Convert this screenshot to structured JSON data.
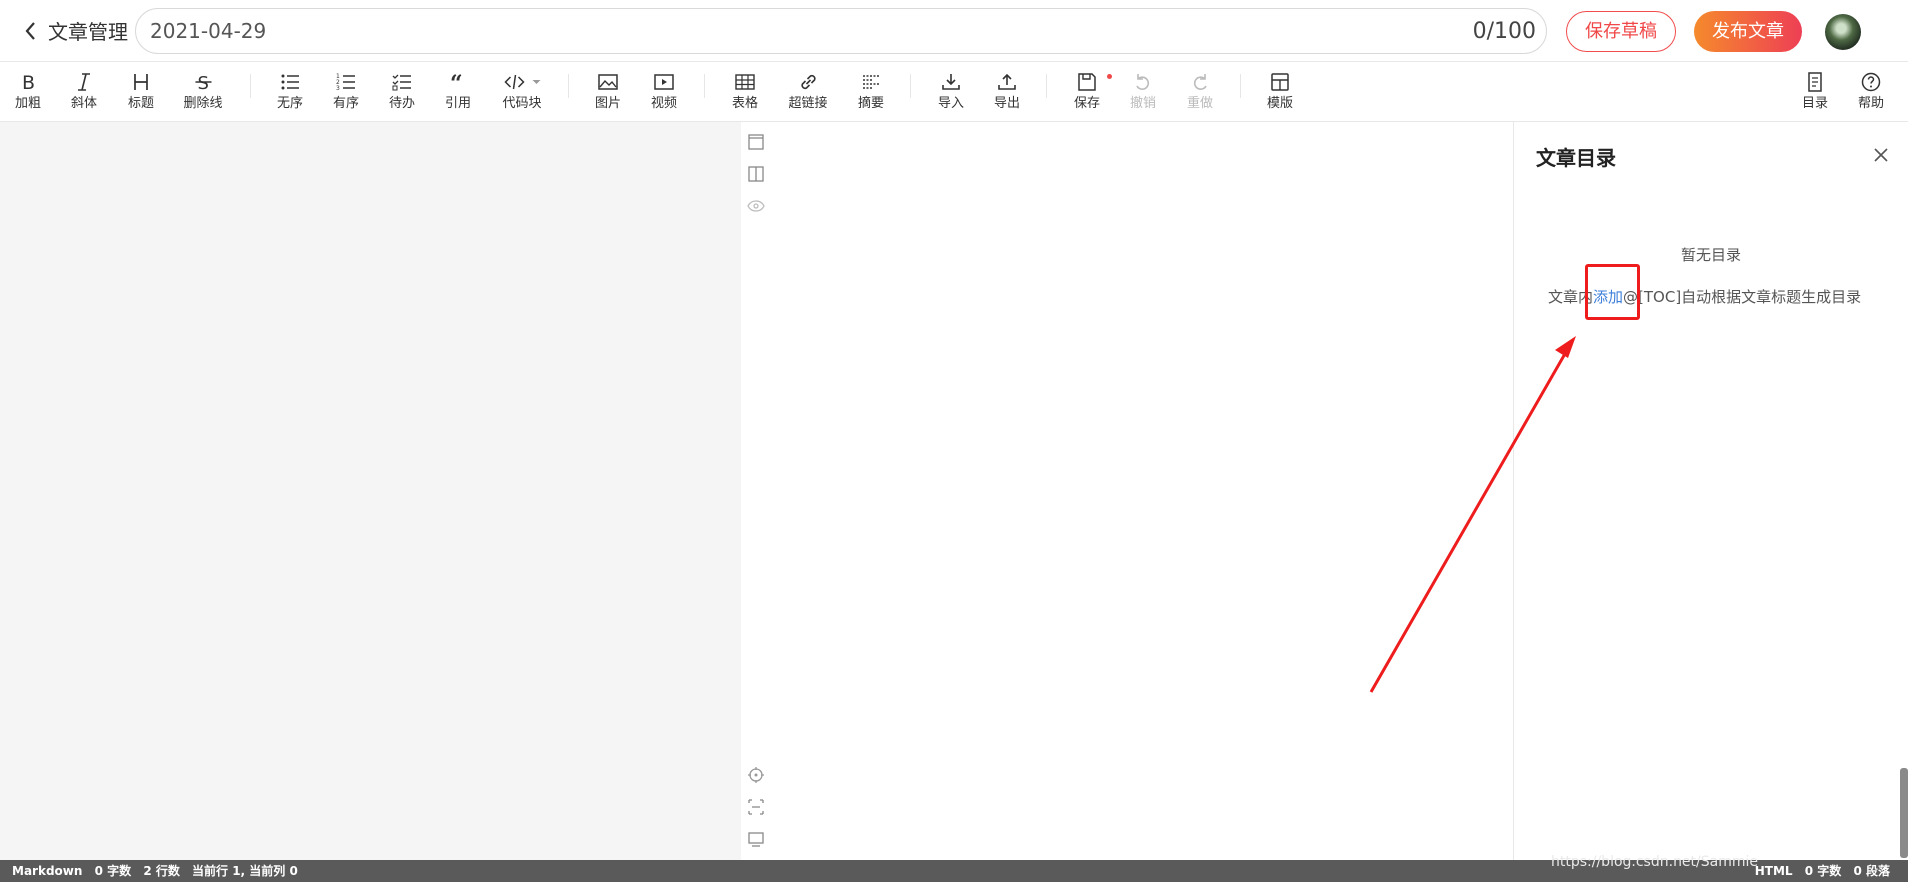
{
  "header": {
    "back_label": "文章管理",
    "title_value": "2021-04-29",
    "title_count": "0/100",
    "save_draft": "保存草稿",
    "publish": "发布文章"
  },
  "toolbar": {
    "bold": "加粗",
    "italic": "斜体",
    "heading": "标题",
    "strike": "删除线",
    "ul": "无序",
    "ol": "有序",
    "todo": "待办",
    "quote": "引用",
    "code": "代码块",
    "image": "图片",
    "video": "视频",
    "table": "表格",
    "link": "超链接",
    "summary": "摘要",
    "import": "导入",
    "export": "导出",
    "save": "保存",
    "undo": "撤销",
    "redo": "重做",
    "template": "模版",
    "toc": "目录",
    "help": "帮助"
  },
  "toc": {
    "title": "文章目录",
    "empty": "暂无目录",
    "hint_before": "文章内",
    "hint_link": "添加",
    "hint_after": "@[TOC]自动根据文章标题生成目录"
  },
  "status": {
    "mode": "Markdown",
    "words": "0 字数",
    "lines": "2 行数",
    "cursor": "当前行 1, 当前列 0",
    "right_mode": "HTML",
    "right_words": "0 字数",
    "right_paras": "0 段落"
  },
  "watermark": "https://blog.csdn.net/Sammie",
  "colors": {
    "accent_red": "#f04848",
    "link_blue": "#3d7fd9",
    "status_bg": "#5a5a5a"
  }
}
